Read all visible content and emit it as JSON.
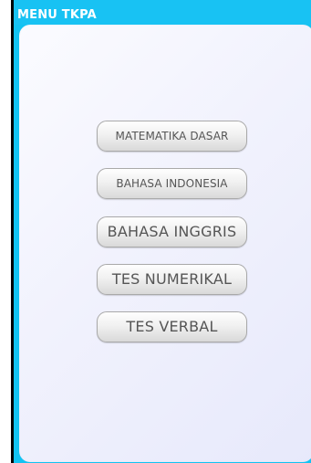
{
  "window": {
    "title": "MENU TKPA"
  },
  "menu": {
    "items": [
      {
        "label": "MATEMATIKA DASAR"
      },
      {
        "label": "BAHASA INDONESIA"
      },
      {
        "label": "BAHASA INGGRIS"
      },
      {
        "label": "TES NUMERIKAL"
      },
      {
        "label": "TES VERBAL"
      }
    ]
  },
  "colors": {
    "title_bar": "#18c2f3",
    "left_border": "#000000",
    "panel": "#f1f2fd",
    "button_text": "#555555"
  }
}
